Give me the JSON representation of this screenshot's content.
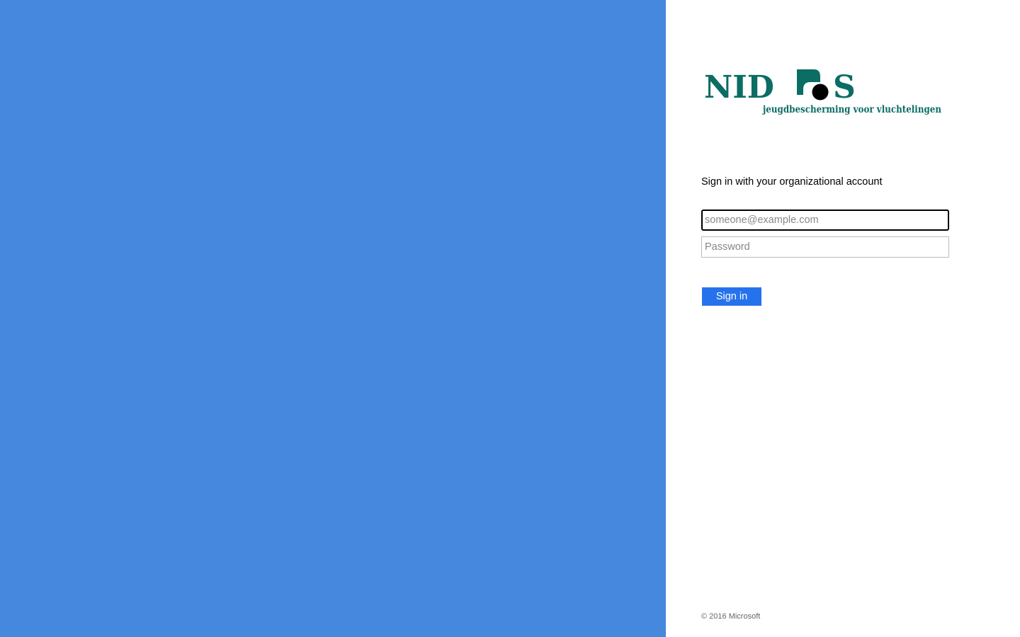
{
  "colors": {
    "illustration_background": "#4688de",
    "accent": "#2672ec",
    "logo_teal": "#0b6d63",
    "logo_dot": "#000000"
  },
  "logo": {
    "wordmark_left": "NID",
    "wordmark_right": "S",
    "tagline": "jeugdbescherming voor vluchtelingen"
  },
  "login": {
    "intro": "Sign in with your organizational account",
    "email_value": "",
    "email_placeholder": "someone@example.com",
    "password_value": "",
    "password_placeholder": "Password",
    "submit_label": "Sign in"
  },
  "footer": {
    "copyright": "© 2016 Microsoft"
  }
}
